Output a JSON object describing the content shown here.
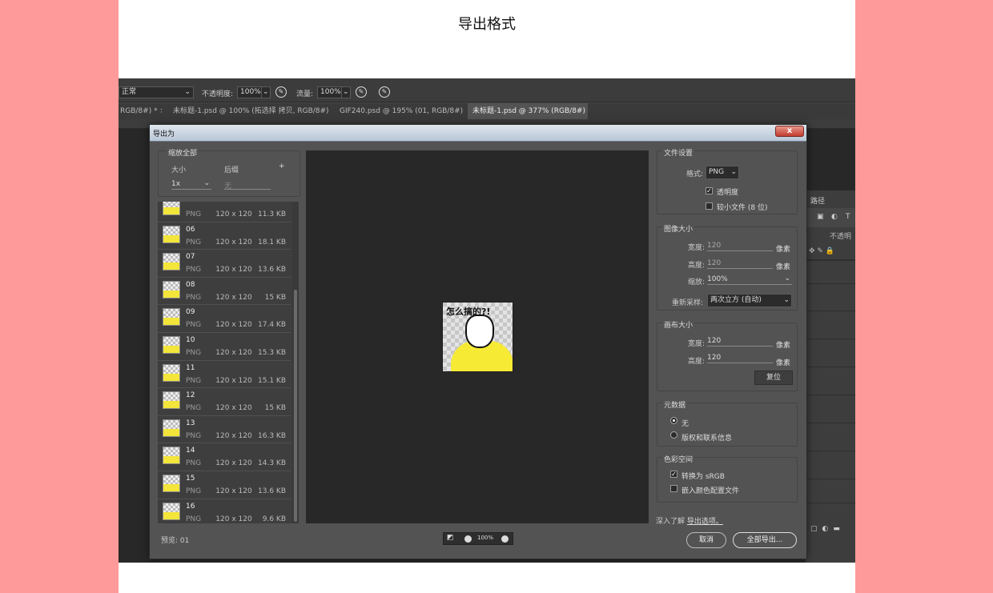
{
  "doc_title": "导出格式",
  "options_bar": {
    "mode": "正常",
    "opacity_label": "不透明度:",
    "opacity_value": "100%",
    "flow_label": "流量:",
    "flow_value": "100%"
  },
  "tabs": [
    {
      "label": "RGB/8#) *",
      "active": false
    },
    {
      "label": "未标题-1.psd @ 100% (拓选择 拷贝, RGB/8#)",
      "active": false
    },
    {
      "label": "GIF240.psd @ 195% (01, RGB/8#) *",
      "active": false
    },
    {
      "label": "未标题-1.psd @ 377% (RGB/8#)",
      "active": true
    }
  ],
  "right_panel": {
    "tab": "路径",
    "opacity_short": "不透明"
  },
  "dialog": {
    "title": "导出为",
    "close": "x",
    "left": {
      "heading": "缩放全部",
      "size_label": "大小",
      "suffix_label": "后缀",
      "add": "+",
      "size_value": "1x",
      "suffix_value": "无"
    },
    "items": [
      {
        "name": "",
        "format": "PNG",
        "dims": "120 x 120",
        "size": "11.3 KB"
      },
      {
        "name": "06",
        "format": "PNG",
        "dims": "120 x 120",
        "size": "18.1 KB"
      },
      {
        "name": "07",
        "format": "PNG",
        "dims": "120 x 120",
        "size": "13.6 KB"
      },
      {
        "name": "08",
        "format": "PNG",
        "dims": "120 x 120",
        "size": "15 KB"
      },
      {
        "name": "09",
        "format": "PNG",
        "dims": "120 x 120",
        "size": "17.4 KB"
      },
      {
        "name": "10",
        "format": "PNG",
        "dims": "120 x 120",
        "size": "15.3 KB"
      },
      {
        "name": "11",
        "format": "PNG",
        "dims": "120 x 120",
        "size": "15.1 KB"
      },
      {
        "name": "12",
        "format": "PNG",
        "dims": "120 x 120",
        "size": "15 KB"
      },
      {
        "name": "13",
        "format": "PNG",
        "dims": "120 x 120",
        "size": "16.3 KB"
      },
      {
        "name": "14",
        "format": "PNG",
        "dims": "120 x 120",
        "size": "14.3 KB"
      },
      {
        "name": "15",
        "format": "PNG",
        "dims": "120 x 120",
        "size": "13.6 KB"
      },
      {
        "name": "16",
        "format": "PNG",
        "dims": "120 x 120",
        "size": "9.6 KB"
      }
    ],
    "preview_caption": "怎么搞的?!",
    "preview_label": "预览: 01",
    "zoom": "100%",
    "file_settings": {
      "heading": "文件设置",
      "format_label": "格式:",
      "format_value": "PNG",
      "transparency": "透明度",
      "transparency_checked": true,
      "smaller_file": "较小文件 (8 位)",
      "smaller_file_checked": false
    },
    "image_size": {
      "heading": "图像大小",
      "width_label": "宽度:",
      "width": "120",
      "height_label": "高度:",
      "height": "120",
      "unit": "像素",
      "scale_label": "缩放:",
      "scale": "100%",
      "resample_label": "重新采样:",
      "resample": "两次立方 (自动)"
    },
    "canvas_size": {
      "heading": "画布大小",
      "width_label": "宽度:",
      "width": "120",
      "height_label": "高度:",
      "height": "120",
      "unit": "像素",
      "reset": "复位"
    },
    "metadata": {
      "heading": "元数据",
      "none": "无",
      "copyright": "版权和联系信息",
      "selected": "none"
    },
    "color_space": {
      "heading": "色彩空间",
      "convert": "转换为 sRGB",
      "convert_checked": true,
      "embed": "嵌入颜色配置文件",
      "embed_checked": false
    },
    "learn_more_prefix": "深入了解",
    "learn_more_link": "导出选项。",
    "cancel": "取消",
    "export_all": "全部导出..."
  }
}
